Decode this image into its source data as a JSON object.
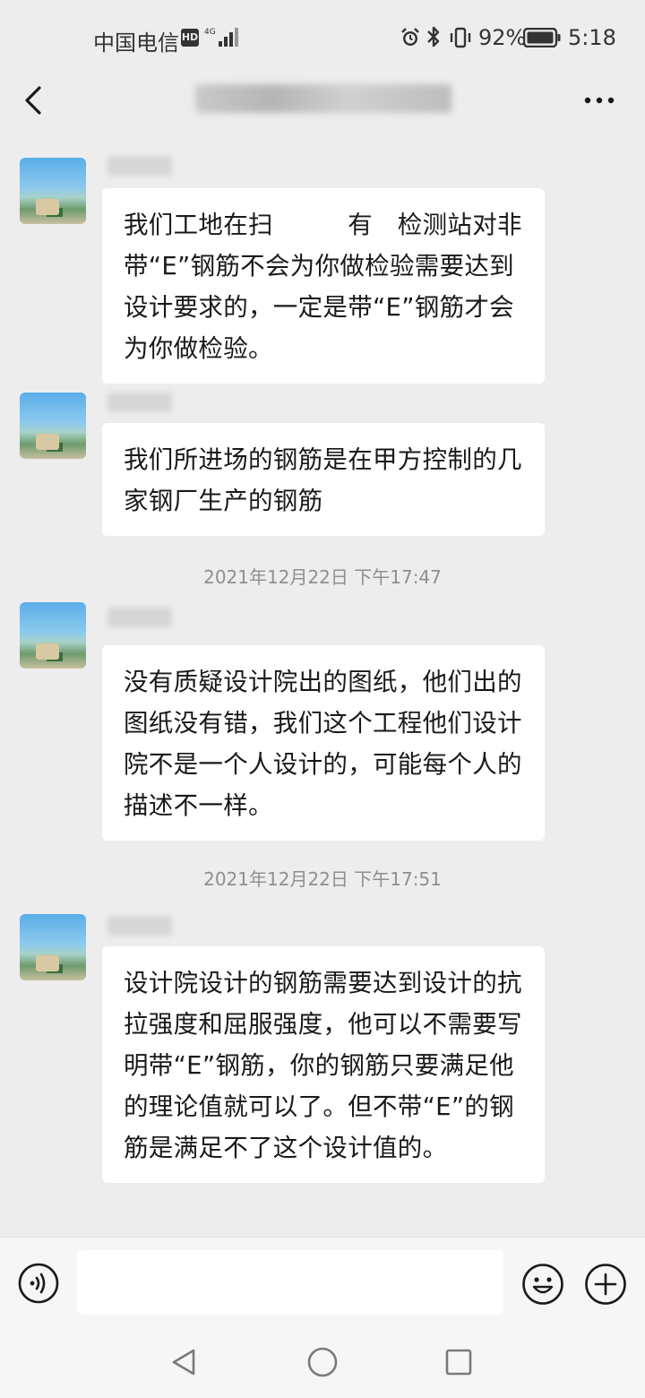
{
  "status_bar": {
    "carrier": "中国电信",
    "hd": "HD",
    "battery": "92%",
    "time": "5:18"
  },
  "nav": {
    "back_icon": "chevron-left-icon",
    "more_icon": "more-horizontal-icon"
  },
  "messages": [
    {
      "type": "received",
      "text": "我们工地在扫　　　有　检测站对非带“E”钢筋不会为你做检验需要达到设计要求的，一定是带“E”钢筋才会为你做检验。"
    },
    {
      "type": "received",
      "text": "我们所进场的钢筋是在甲方控制的几家钢厂生产的钢筋"
    },
    {
      "type": "timestamp",
      "text": "2021年12月22日 下午17:47"
    },
    {
      "type": "received",
      "text": "没有质疑设计院出的图纸，他们出的图纸没有错，我们这个工程他们设计院不是一个人设计的，可能每个人的描述不一样。"
    },
    {
      "type": "timestamp",
      "text": "2021年12月22日 下午17:51"
    },
    {
      "type": "received",
      "text": "设计院设计的钢筋需要达到设计的抗拉强度和屈服强度，他可以不需要写明带“E”钢筋，你的钢筋只要满足他的理论值就可以了。但不带“E”的钢筋是满足不了这个设计值的。"
    }
  ],
  "input_bar": {
    "voice_icon": "voice-icon",
    "input_value": "",
    "emoji_icon": "emoji-icon",
    "plus_icon": "plus-circle-icon"
  }
}
